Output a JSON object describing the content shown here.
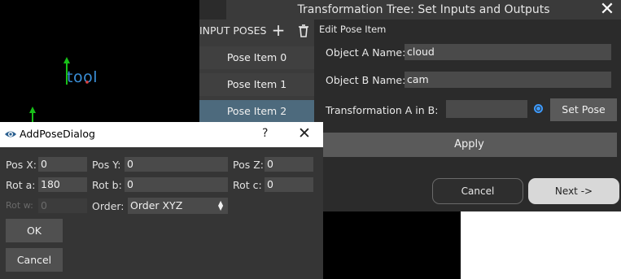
{
  "viewport": {
    "frame_label": "tool"
  },
  "main_dialog": {
    "title": "Transformation Tree: Set Inputs and Outputs",
    "input_poses_label": "INPUT POSES",
    "add_icon": "plus-icon",
    "delete_icon": "trash-icon",
    "pose_items": [
      "Pose Item 0",
      "Pose Item 1",
      "Pose Item 2"
    ],
    "selected_pose": "Pose Item 2",
    "edit": {
      "title": "Edit Pose Item",
      "object_a_label": "Object A Name:",
      "object_a_value": "cloud",
      "object_b_label": "Object B Name:",
      "object_b_value": "cam",
      "transform_label": "Transformation A in B:",
      "transform_value": "",
      "set_pose_label": "Set Pose",
      "apply_label": "Apply"
    },
    "cancel_label": "Cancel",
    "next_label": "Next ->"
  },
  "add_pose_dialog": {
    "title": "AddPoseDialog",
    "help": "?",
    "pos_x_label": "Pos X:",
    "pos_x": "0",
    "pos_y_label": "Pos Y:",
    "pos_y": "0",
    "pos_z_label": "Pos Z:",
    "pos_z": "0",
    "rot_a_label": "Rot a:",
    "rot_a": "180",
    "rot_b_label": "Rot b:",
    "rot_b": "0",
    "rot_c_label": "Rot c:",
    "rot_c": "0",
    "rot_w_label": "Rot w:",
    "rot_w": "0",
    "order_label": "Order:",
    "order_value": "Order XYZ",
    "ok_label": "OK",
    "cancel_label": "Cancel"
  },
  "colors": {
    "accent": "#3d9bff",
    "selected_item": "#4d6a7d",
    "frame_label": "#3a8fd8"
  }
}
